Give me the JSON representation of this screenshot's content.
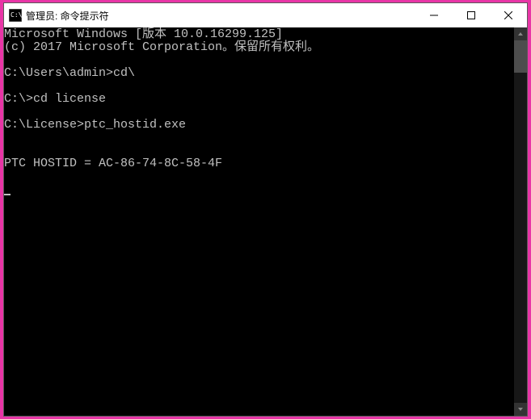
{
  "window": {
    "title": "管理员: 命令提示符"
  },
  "terminal": {
    "line1": "Microsoft Windows [版本 10.0.16299.125]",
    "line2": "(c) 2017 Microsoft Corporation。保留所有权利。",
    "line3": "",
    "line4_prompt": "C:\\Users\\admin>",
    "line4_cmd": "cd\\",
    "line5": "",
    "line6_prompt": "C:\\>",
    "line6_cmd": "cd license",
    "line7": "",
    "line8_prompt": "C:\\License>",
    "line8_cmd": "ptc_hostid.exe",
    "line9": "",
    "line10": "",
    "line11": "PTC HOSTID = AC-86-74-8C-58-4F",
    "line12": ""
  }
}
